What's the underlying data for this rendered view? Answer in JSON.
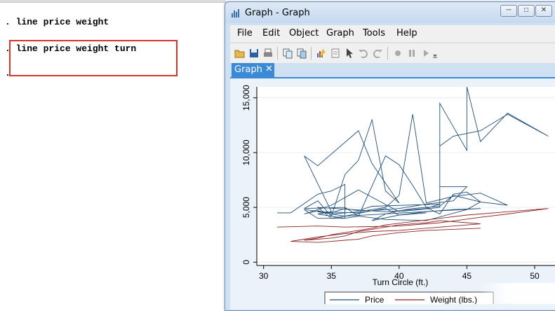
{
  "results": {
    "lines": [
      ". line price weight",
      ". line price weight turn"
    ],
    "prompt": "."
  },
  "window": {
    "title": "Graph - Graph",
    "minimize_label": "─",
    "maximize_label": "□",
    "close_label": "✕"
  },
  "menu": [
    "File",
    "Edit",
    "Object",
    "Graph",
    "Tools",
    "Help"
  ],
  "toolbar_icons": [
    "open-icon",
    "save-icon",
    "print-icon",
    "copy-icon",
    "copy-graph-icon",
    "graph-editor-icon",
    "rename-icon",
    "pointer-icon",
    "undo-icon",
    "redo-icon",
    "record-icon",
    "pause-icon",
    "play-icon",
    "dropdown-icon"
  ],
  "tab": {
    "label": "Graph",
    "close": "✕"
  },
  "colors": {
    "price": "#1f4e79",
    "weight": "#8b2323",
    "tab": "#3a8ad8",
    "highlight": "#d9342b"
  },
  "chart_data": {
    "type": "line",
    "xlabel": "Turn Circle (ft.)",
    "ylabel": "",
    "xticks": [
      30,
      35,
      40,
      45,
      50
    ],
    "yticks": [
      0,
      5000,
      10000,
      15000
    ],
    "ytick_labels": [
      "0",
      "5,000",
      "10,000",
      "15,000"
    ],
    "xlim": [
      29.5,
      51.5
    ],
    "ylim": [
      -300,
      16000
    ],
    "grid": true,
    "legend": "bottom",
    "series": [
      {
        "name": "Price",
        "color": "#1f4e79",
        "x": [
          31,
          32,
          34,
          35,
          36,
          36,
          34,
          35,
          33,
          34,
          37,
          38,
          40,
          39,
          38,
          37,
          36,
          35,
          34,
          33,
          36,
          37,
          39,
          40,
          41,
          42,
          43,
          44,
          45,
          46,
          48,
          46,
          44,
          42,
          41,
          40,
          39,
          38,
          37,
          36,
          35,
          34,
          33,
          35,
          37,
          40,
          43,
          43,
          45,
          45,
          46,
          48,
          51,
          48,
          46,
          44,
          43,
          43,
          45,
          44,
          42,
          40,
          38,
          36,
          35,
          34,
          39,
          41,
          42,
          43,
          38,
          37,
          36,
          35,
          33,
          34,
          36,
          37,
          39,
          42,
          45,
          46,
          44,
          43,
          41,
          40,
          39,
          38,
          40,
          42,
          44,
          46,
          36,
          34,
          37,
          39,
          40,
          42
        ],
        "y": [
          4500,
          4500,
          6200,
          6500,
          7100,
          4000,
          4400,
          4600,
          9700,
          8800,
          12000,
          9000,
          5400,
          6500,
          13000,
          9300,
          8000,
          4200,
          5600,
          4900,
          5000,
          4200,
          9700,
          8900,
          7000,
          5000,
          4400,
          6200,
          6400,
          5500,
          5200,
          6300,
          6000,
          5400,
          13500,
          6100,
          5000,
          4800,
          4600,
          4500,
          4400,
          4700,
          4400,
          5200,
          6600,
          4600,
          5000,
          14500,
          10200,
          16000,
          11000,
          13600,
          11500,
          13500,
          12000,
          11500,
          10600,
          6900,
          6900,
          5600,
          5300,
          4900,
          4700,
          4200,
          4000,
          5000,
          4600,
          4800,
          4900,
          5300,
          5100,
          4700,
          4900,
          4500,
          4800,
          4000,
          4000,
          4200,
          3900,
          3800,
          4800,
          5500,
          6100,
          5100,
          4900,
          4700,
          4400,
          3800,
          4300,
          4600,
          4800,
          4900,
          4200,
          4600,
          4500,
          4900,
          4300,
          4500
        ]
      },
      {
        "name": "Weight (lbs.)",
        "color": "#8b2323",
        "x": [
          31,
          34,
          36,
          40,
          43,
          46,
          48,
          51,
          48,
          45,
          43,
          41,
          39,
          38,
          37,
          36,
          35,
          34,
          33,
          35,
          36,
          37,
          38,
          39,
          40,
          41,
          42,
          43,
          44,
          45,
          46,
          44,
          42,
          40,
          38,
          36,
          34,
          33,
          32,
          34,
          35,
          36,
          37,
          38,
          40,
          42,
          44,
          46
        ],
        "y": [
          3200,
          3300,
          3200,
          3300,
          3600,
          4100,
          4400,
          4900,
          4600,
          4300,
          4000,
          3700,
          3400,
          3100,
          2900,
          2700,
          2500,
          2200,
          2000,
          2200,
          2400,
          2800,
          3000,
          3200,
          3400,
          3500,
          3600,
          3800,
          3700,
          3600,
          3500,
          3300,
          3100,
          2900,
          2800,
          2600,
          2300,
          2100,
          1900,
          1800,
          1900,
          2000,
          2100,
          2400,
          2700,
          2900,
          3000,
          3100
        ]
      }
    ]
  }
}
